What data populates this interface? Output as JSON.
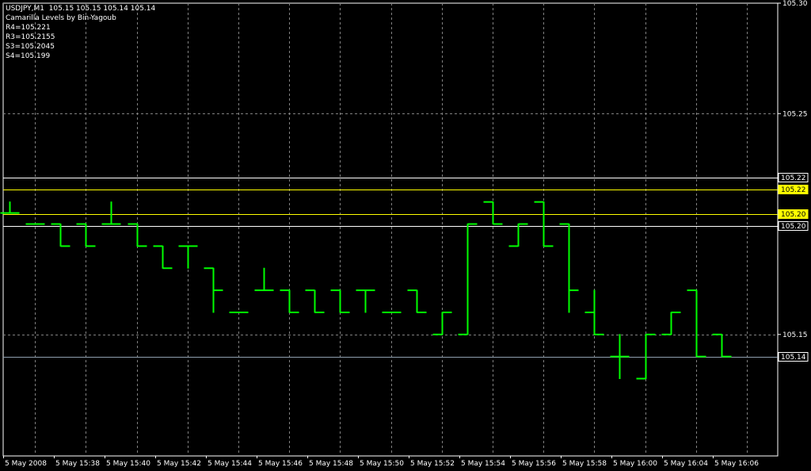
{
  "header": {
    "symbol_line": "USDJPY,M1  105.15 105.15 105.14 105.14",
    "indicator_name": "Camarilla Levels by Bin-Yagoub",
    "levels_text": [
      "R4=105.221",
      "R3=105.2155",
      "S3=105.2045",
      "S4=105.199"
    ]
  },
  "colors": {
    "background": "#000000",
    "bars": "#00ff00",
    "grid": "#808080",
    "camarilla_r": "#ffffff",
    "camarilla_inner": "#ffff00",
    "bid_line": "#8fa0b0",
    "axis": "#ffffff"
  },
  "chart_data": {
    "type": "ohlc",
    "symbol": "USDJPY",
    "timeframe": "M1",
    "ylim": [
      105.095,
      105.3
    ],
    "y_ticks": [
      "105.30",
      "105.25",
      "105.15"
    ],
    "x_ticks": [
      "5 May 2008",
      "5 May 15:38",
      "5 May 15:40",
      "5 May 15:42",
      "5 May 15:44",
      "5 May 15:46",
      "5 May 15:48",
      "5 May 15:50",
      "5 May 15:52",
      "5 May 15:54",
      "5 May 15:56",
      "5 May 15:58",
      "5 May 16:00",
      "5 May 16:04",
      "5 May 16:06"
    ],
    "bars": [
      {
        "o": 105.205,
        "h": 105.21,
        "l": 105.205,
        "c": 105.205
      },
      {
        "o": 105.2,
        "h": 105.2,
        "l": 105.2,
        "c": 105.2
      },
      {
        "o": 105.2,
        "h": 105.2,
        "l": 105.19,
        "c": 105.19
      },
      {
        "o": 105.2,
        "h": 105.2,
        "l": 105.19,
        "c": 105.19
      },
      {
        "o": 105.2,
        "h": 105.21,
        "l": 105.2,
        "c": 105.2
      },
      {
        "o": 105.2,
        "h": 105.2,
        "l": 105.19,
        "c": 105.19
      },
      {
        "o": 105.19,
        "h": 105.19,
        "l": 105.18,
        "c": 105.18
      },
      {
        "o": 105.19,
        "h": 105.19,
        "l": 105.18,
        "c": 105.19
      },
      {
        "o": 105.18,
        "h": 105.18,
        "l": 105.16,
        "c": 105.17
      },
      {
        "o": 105.16,
        "h": 105.16,
        "l": 105.16,
        "c": 105.16
      },
      {
        "o": 105.17,
        "h": 105.18,
        "l": 105.17,
        "c": 105.17
      },
      {
        "o": 105.17,
        "h": 105.17,
        "l": 105.16,
        "c": 105.16
      },
      {
        "o": 105.17,
        "h": 105.17,
        "l": 105.16,
        "c": 105.16
      },
      {
        "o": 105.17,
        "h": 105.17,
        "l": 105.16,
        "c": 105.16
      },
      {
        "o": 105.17,
        "h": 105.17,
        "l": 105.16,
        "c": 105.17
      },
      {
        "o": 105.16,
        "h": 105.16,
        "l": 105.16,
        "c": 105.16
      },
      {
        "o": 105.17,
        "h": 105.17,
        "l": 105.16,
        "c": 105.16
      },
      {
        "o": 105.15,
        "h": 105.16,
        "l": 105.15,
        "c": 105.16
      },
      {
        "o": 105.15,
        "h": 105.2,
        "l": 105.15,
        "c": 105.2
      },
      {
        "o": 105.21,
        "h": 105.21,
        "l": 105.2,
        "c": 105.2
      },
      {
        "o": 105.19,
        "h": 105.2,
        "l": 105.19,
        "c": 105.2
      },
      {
        "o": 105.21,
        "h": 105.21,
        "l": 105.19,
        "c": 105.19
      },
      {
        "o": 105.2,
        "h": 105.2,
        "l": 105.16,
        "c": 105.17
      },
      {
        "o": 105.16,
        "h": 105.17,
        "l": 105.15,
        "c": 105.15
      },
      {
        "o": 105.14,
        "h": 105.15,
        "l": 105.13,
        "c": 105.14
      },
      {
        "o": 105.13,
        "h": 105.15,
        "l": 105.13,
        "c": 105.15
      },
      {
        "o": 105.15,
        "h": 105.16,
        "l": 105.15,
        "c": 105.16
      },
      {
        "o": 105.17,
        "h": 105.17,
        "l": 105.14,
        "c": 105.14
      },
      {
        "o": 105.15,
        "h": 105.15,
        "l": 105.14,
        "c": 105.14
      }
    ],
    "levels": [
      {
        "name": "R4",
        "value": 105.221,
        "label": "105.22",
        "color": "#ffffff"
      },
      {
        "name": "R3",
        "value": 105.2155,
        "label": "105.22",
        "color": "#ffff00"
      },
      {
        "name": "S3",
        "value": 105.2045,
        "label": "105.20",
        "color": "#ffff00"
      },
      {
        "name": "S4",
        "value": 105.199,
        "label": "105.20",
        "color": "#ffffff"
      }
    ],
    "bid_line": {
      "value": 105.14,
      "label": "105.14"
    }
  }
}
